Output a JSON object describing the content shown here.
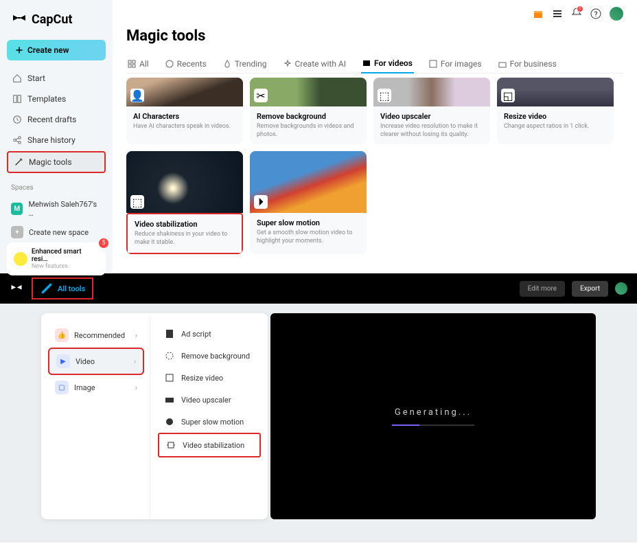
{
  "brand": "CapCut",
  "sidebar": {
    "create": "Create new",
    "nav": [
      {
        "label": "Start"
      },
      {
        "label": "Templates"
      },
      {
        "label": "Recent drafts"
      },
      {
        "label": "Share history"
      },
      {
        "label": "Magic tools"
      }
    ],
    "spaces_label": "Spaces",
    "space1": "Mehwish Saleh767's …",
    "space2": "Create new space",
    "feature_title": "Enhanced smart resi…",
    "feature_sub": "New features.",
    "feature_badge": "5"
  },
  "page_title": "Magic tools",
  "tabs": [
    {
      "label": "All"
    },
    {
      "label": "Recents"
    },
    {
      "label": "Trending"
    },
    {
      "label": "Create with AI"
    },
    {
      "label": "For videos"
    },
    {
      "label": "For images"
    },
    {
      "label": "For business"
    }
  ],
  "cards": [
    {
      "title": "AI Characters",
      "desc": "Have AI characters speak in videos."
    },
    {
      "title": "Remove background",
      "desc": "Remove backgrounds in videos and photos."
    },
    {
      "title": "Video upscaler",
      "desc": "Increase video resolution to make it clearer without losing its quality."
    },
    {
      "title": "Resize video",
      "desc": "Change aspect ratios in 1 click."
    },
    {
      "title": "Video stabilization",
      "desc": "Reduce shakiness in your video to make it stable."
    },
    {
      "title": "Super slow motion",
      "desc": "Get a smooth slow motion video to highlight your moments."
    }
  ],
  "editor": {
    "all_tools": "All tools",
    "edit_more": "Edit more",
    "export": "Export",
    "categories": [
      {
        "label": "Recommended"
      },
      {
        "label": "Video"
      },
      {
        "label": "Image"
      }
    ],
    "submenu": [
      {
        "label": "Ad script"
      },
      {
        "label": "Remove background"
      },
      {
        "label": "Resize video"
      },
      {
        "label": "Video upscaler"
      },
      {
        "label": "Super slow motion"
      },
      {
        "label": "Video stabilization"
      }
    ],
    "generating": "Generating..."
  }
}
